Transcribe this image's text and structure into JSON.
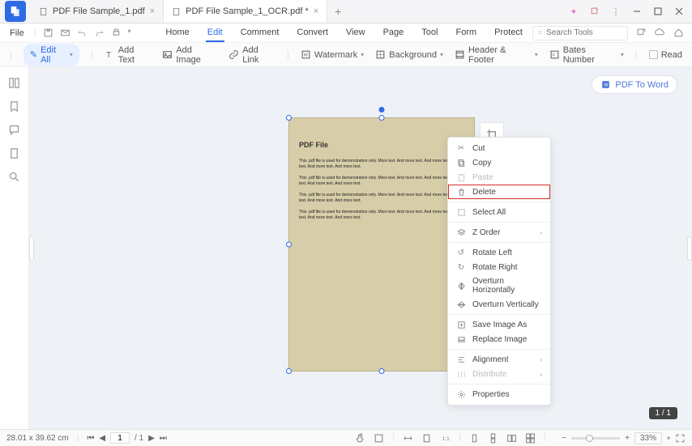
{
  "tabs": [
    {
      "label": "PDF File Sample_1.pdf"
    },
    {
      "label": "PDF File Sample_1_OCR.pdf *"
    }
  ],
  "row2": {
    "file": "File",
    "menu": [
      "Home",
      "Edit",
      "Comment",
      "Convert",
      "View",
      "Page",
      "Tool",
      "Form",
      "Protect"
    ],
    "active": "Edit",
    "search_ph": "Search Tools"
  },
  "toolbar": {
    "editall": "Edit All",
    "addtext": "Add Text",
    "addimage": "Add Image",
    "addlink": "Add Link",
    "watermark": "Watermark",
    "background": "Background",
    "headerfooter": "Header & Footer",
    "batesnumber": "Bates Number",
    "read": "Read"
  },
  "floatbtn": "PDF To Word",
  "page_doc": {
    "title": "PDF File",
    "para": "This .pdf file is used for demonstration only. More text. And more text. And more text. More text. And more text. And more text."
  },
  "context": {
    "cut": "Cut",
    "copy": "Copy",
    "paste": "Paste",
    "delete": "Delete",
    "selectall": "Select All",
    "zorder": "Z Order",
    "rotl": "Rotate Left",
    "rotr": "Rotate Right",
    "ovh": "Overturn Horizontally",
    "ovv": "Overturn Vertically",
    "saveimg": "Save Image As",
    "replimg": "Replace Image",
    "align": "Alignment",
    "distribute": "Distribute",
    "props": "Properties"
  },
  "pagebadge": "1 / 1",
  "status": {
    "dims": "28.01 x 39.62 cm",
    "page_cur": "1",
    "page_total": "/ 1",
    "zoom": "33%"
  }
}
